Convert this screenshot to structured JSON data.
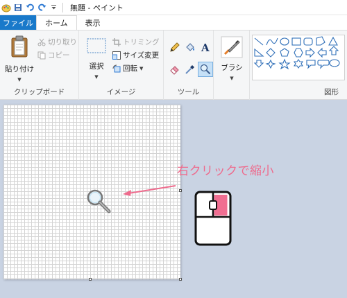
{
  "window": {
    "title": "無題 - ペイント"
  },
  "tabs": [
    {
      "label": "ファイル"
    },
    {
      "label": "ホーム"
    },
    {
      "label": "表示"
    }
  ],
  "ribbon": {
    "clipboard": {
      "paste": "貼り付け",
      "cut": "切り取り",
      "copy": "コピー",
      "label": "クリップボード"
    },
    "image": {
      "select": "選択",
      "crop": "トリミング",
      "resize": "サイズ変更",
      "rotate": "回転",
      "label": "イメージ"
    },
    "tools": {
      "label": "ツール",
      "items": [
        "pencil-icon",
        "fill-icon",
        "text-icon",
        "eraser-icon",
        "color-picker-icon",
        "magnifier-icon"
      ],
      "active": "magnifier-icon"
    },
    "brushes": {
      "label": "ブラシ"
    },
    "shapes": {
      "label": "図形"
    }
  },
  "annotation": {
    "text": "右クリックで縮小",
    "color": "#ee6b8d"
  },
  "colors": {
    "file_tab": "#1979ca",
    "accent_pink": "#ee6b8d",
    "tool_active": "#c5e0f7"
  }
}
